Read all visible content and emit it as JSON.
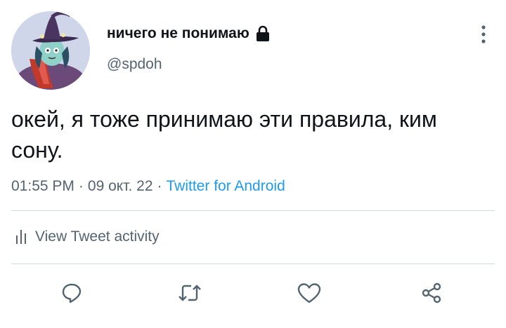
{
  "author": {
    "display_name": "ничего не понимаю",
    "handle": "@spdoh",
    "protected": true,
    "lock_icon": "lock-icon",
    "avatar": "avatar"
  },
  "tweet": {
    "text": "окей, я тоже принимаю эти правила, ким сону.",
    "time": "01:55 PM",
    "date": "09 окт. 22",
    "separator": "·",
    "source": "Twitter for Android"
  },
  "activity": {
    "label": "View Tweet activity",
    "icon": "bar-chart-icon"
  },
  "actions": [
    {
      "name": "reply",
      "icon": "reply-icon"
    },
    {
      "name": "retweet",
      "icon": "retweet-icon"
    },
    {
      "name": "like",
      "icon": "heart-icon"
    },
    {
      "name": "share",
      "icon": "share-icon"
    }
  ],
  "colors": {
    "text": "#0f1419",
    "secondary": "#536471",
    "link": "#1d9bf0",
    "divider": "#cfd9de",
    "background": "#ffffff"
  }
}
